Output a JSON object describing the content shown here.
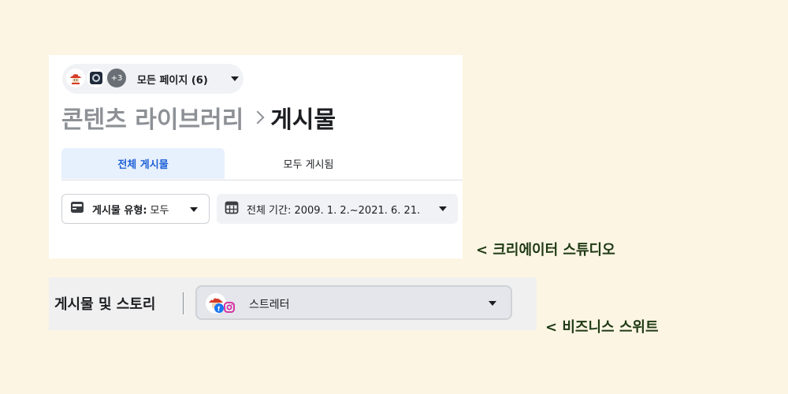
{
  "creator_studio": {
    "page_selector": {
      "label": "모든 페이지 (6)",
      "extra_count": "+3"
    },
    "breadcrumb": {
      "parent": "콘텐츠 라이브러리",
      "current": "게시물"
    },
    "tabs": [
      {
        "label": "전체 게시물",
        "active": true
      },
      {
        "label": "모두 게시됨",
        "active": false
      }
    ],
    "filters": {
      "post_type_label": "게시물 유형:",
      "post_type_value": "모두",
      "date_range": "전체 기간: 2009. 1. 2.~2021. 6. 21."
    }
  },
  "business_suite": {
    "label": "게시물 및 스토리",
    "account_name": "스트레터"
  },
  "annotations": {
    "creator_studio": "< 크리에이터 스튜디오",
    "business_suite": "< 비즈니스 스위트"
  },
  "colors": {
    "background": "#fdf5e4",
    "tab_active_bg": "#e7f0fd",
    "tab_active_text": "#1b5fd6",
    "annotation": "#1e3a14"
  }
}
